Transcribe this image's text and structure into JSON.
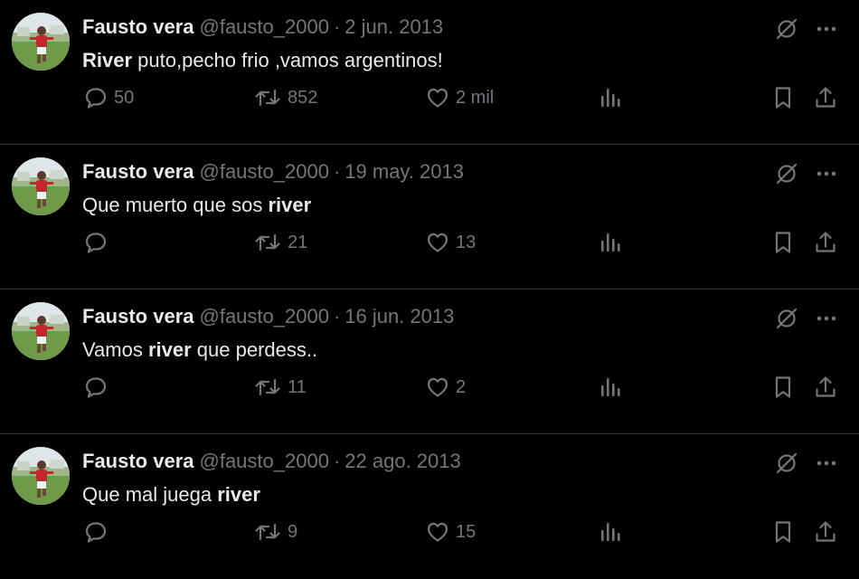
{
  "colors": {
    "background": "#000000",
    "primary_text": "#e7e9ea",
    "secondary_text": "#71767b",
    "divider": "#2f3336"
  },
  "tweets": [
    {
      "name": "Fausto vera",
      "handle": "@fausto_2000",
      "separator": "·",
      "date": "2 jun. 2013",
      "text": [
        {
          "t": "River",
          "b": true
        },
        {
          "t": " puto,pecho frio ,vamos argentinos!",
          "b": false
        }
      ],
      "replies": "50",
      "retweets": "852",
      "likes": "2 mil"
    },
    {
      "name": "Fausto vera",
      "handle": "@fausto_2000",
      "separator": "·",
      "date": "19 may. 2013",
      "text": [
        {
          "t": "Que muerto que sos ",
          "b": false
        },
        {
          "t": "river",
          "b": true
        }
      ],
      "replies": "",
      "retweets": "21",
      "likes": "13"
    },
    {
      "name": "Fausto vera",
      "handle": "@fausto_2000",
      "separator": "·",
      "date": "16 jun. 2013",
      "text": [
        {
          "t": "Vamos ",
          "b": false
        },
        {
          "t": "river",
          "b": true
        },
        {
          "t": " que perdess..",
          "b": false
        }
      ],
      "replies": "",
      "retweets": "11",
      "likes": "2"
    },
    {
      "name": "Fausto vera",
      "handle": "@fausto_2000",
      "separator": "·",
      "date": "22 ago. 2013",
      "text": [
        {
          "t": "Que mal juega ",
          "b": false
        },
        {
          "t": "river",
          "b": true
        }
      ],
      "replies": "",
      "retweets": "9",
      "likes": "15"
    }
  ],
  "icons": {
    "avatar": "profile-photo",
    "grok": "grok-icon",
    "more": "more-icon",
    "reply": "reply-icon",
    "retweet": "retweet-icon",
    "like": "heart-icon",
    "views": "views-icon",
    "bookmark": "bookmark-icon",
    "share": "share-icon"
  }
}
